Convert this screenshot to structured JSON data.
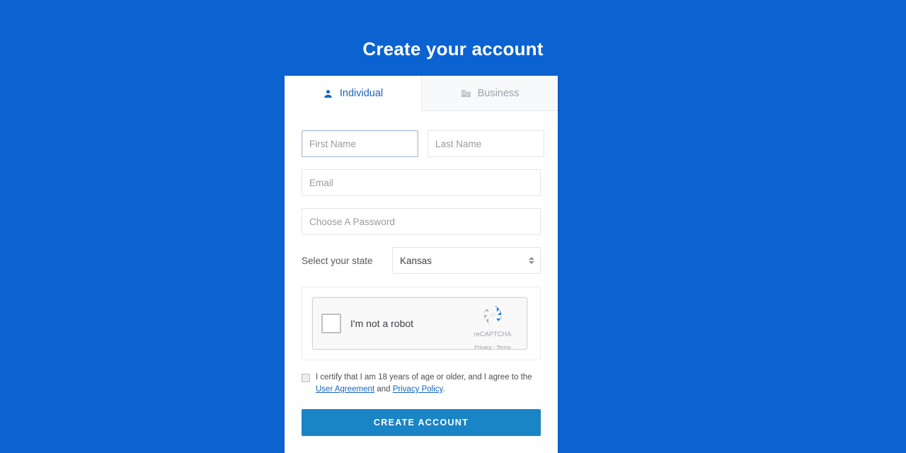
{
  "page": {
    "title": "Create your account",
    "background_color": "#0b62d1"
  },
  "card": {
    "tabs": [
      {
        "label": "Individual",
        "icon": "person-icon",
        "active": true
      },
      {
        "label": "Business",
        "icon": "building-icon",
        "active": false
      }
    ],
    "form": {
      "first_name": {
        "placeholder": "First Name",
        "value": "",
        "focused": true
      },
      "last_name": {
        "placeholder": "Last Name",
        "value": ""
      },
      "email": {
        "placeholder": "Email",
        "value": ""
      },
      "password": {
        "placeholder": "Choose A Password",
        "value": ""
      },
      "state": {
        "label": "Select your state",
        "selected": "Kansas"
      }
    },
    "captcha": {
      "label": "I'm not a robot",
      "brand": "reCAPTCHA",
      "links": "Privacy - Terms",
      "checked": false
    },
    "certify": {
      "text_before": "I certify that I am 18 years of age or older, and I agree to the",
      "link_user_agreement": "User Agreement",
      "conjunction": "and",
      "link_privacy_policy": "Privacy Policy",
      "period": ".",
      "checked": false
    },
    "submit": {
      "label": "CREATE ACCOUNT",
      "color": "#1a85c6"
    }
  }
}
